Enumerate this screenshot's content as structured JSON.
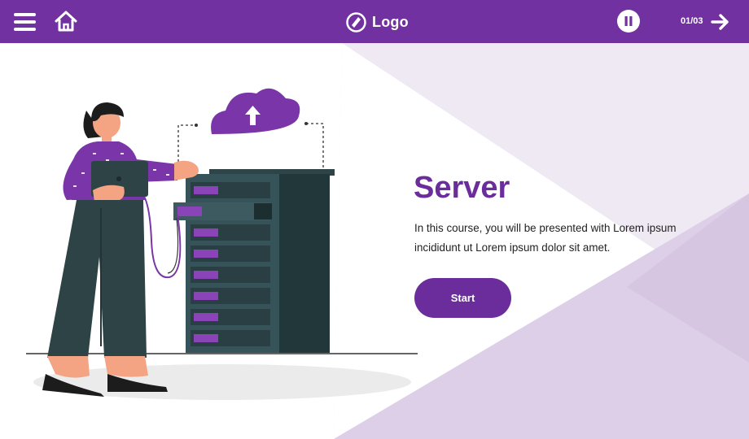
{
  "header": {
    "logo_text": "Logo",
    "progress": "01/03",
    "background_color": "#7231a0",
    "icons": [
      "menu-icon",
      "home-icon",
      "logo-icon",
      "pause-icon",
      "arrow-right-icon"
    ]
  },
  "hero": {
    "title": "Server",
    "description": "In this course, you will be presented with Lorem ipsum incididunt ut Lorem ipsum dolor sit amet.",
    "start_label": "Start"
  },
  "colors": {
    "accent": "#6c2d9c",
    "light_purple": "#efe9f4",
    "mid_purple": "#dccfe7"
  }
}
